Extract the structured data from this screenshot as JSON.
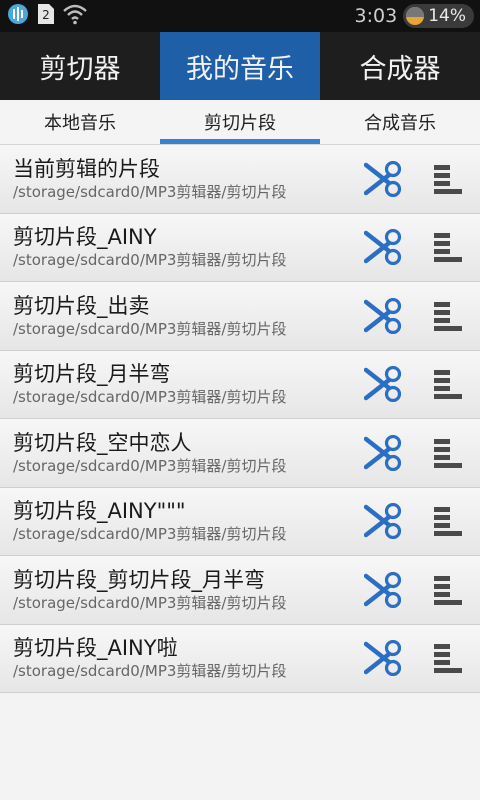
{
  "status_bar": {
    "notification_icons": [
      "app-icon",
      "sim-2-icon",
      "wifi-icon"
    ],
    "sim_label": "2",
    "time": "3:03",
    "battery": "14%",
    "battery_level": 0.14
  },
  "top_tabs": [
    {
      "label": "剪切器",
      "active": false
    },
    {
      "label": "我的音乐",
      "active": true
    },
    {
      "label": "合成器",
      "active": false
    }
  ],
  "sub_tabs": [
    {
      "label": "本地音乐",
      "active": false
    },
    {
      "label": "剪切片段",
      "active": true
    },
    {
      "label": "合成音乐",
      "active": false
    }
  ],
  "items": [
    {
      "title": "当前剪辑的片段",
      "path": "/storage/sdcard0/MP3剪辑器/剪切片段"
    },
    {
      "title": "剪切片段_AINY",
      "path": "/storage/sdcard0/MP3剪辑器/剪切片段"
    },
    {
      "title": "剪切片段_出卖",
      "path": "/storage/sdcard0/MP3剪辑器/剪切片段"
    },
    {
      "title": "剪切片段_月半弯",
      "path": "/storage/sdcard0/MP3剪辑器/剪切片段"
    },
    {
      "title": "剪切片段_空中恋人",
      "path": "/storage/sdcard0/MP3剪辑器/剪切片段"
    },
    {
      "title": "剪切片段_AINY\"\"\"",
      "path": "/storage/sdcard0/MP3剪辑器/剪切片段"
    },
    {
      "title": "剪切片段_剪切片段_月半弯",
      "path": "/storage/sdcard0/MP3剪辑器/剪切片段"
    },
    {
      "title": "剪切片段_AINY啦",
      "path": "/storage/sdcard0/MP3剪辑器/剪切片段"
    }
  ],
  "colors": {
    "active_tab": "#1f5fa8",
    "accent": "#3b7fcf",
    "scissors": "#2a6fc4"
  },
  "icons": {
    "row_action": "scissors-icon",
    "row_menu": "menu-icon"
  }
}
